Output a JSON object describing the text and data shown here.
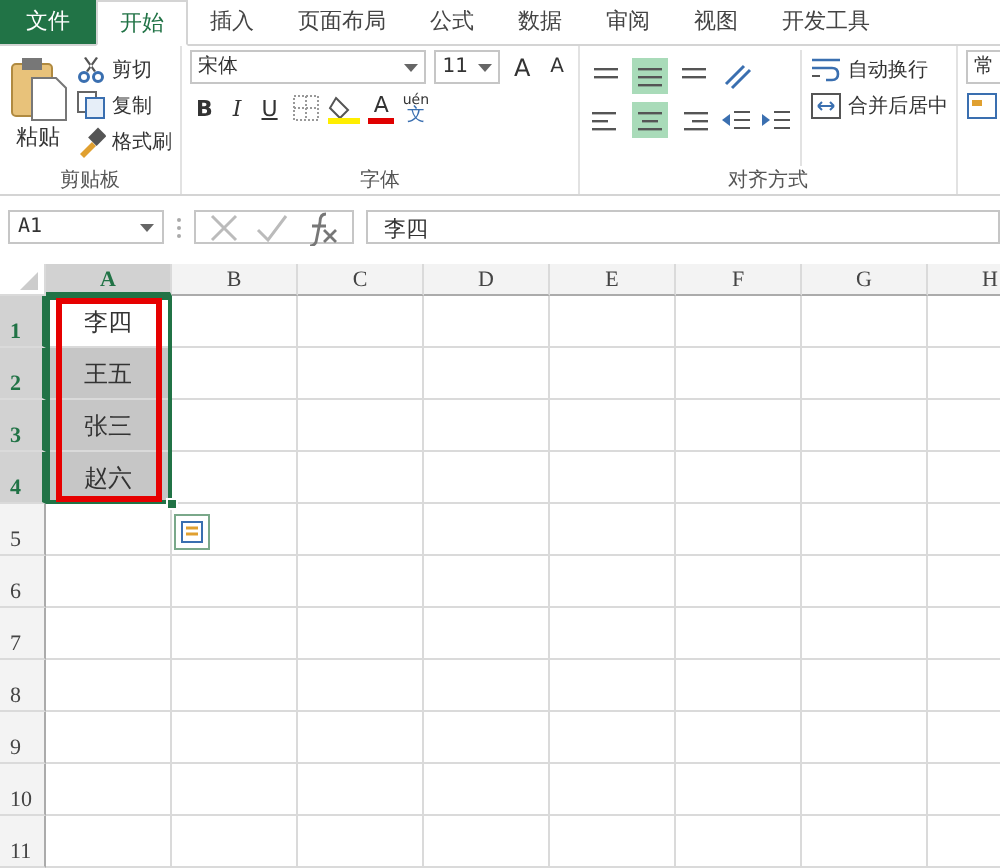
{
  "tabs": [
    {
      "label": "文件",
      "kind": "file",
      "selected": false
    },
    {
      "label": "开始",
      "kind": "tab",
      "selected": true
    },
    {
      "label": "插入",
      "kind": "tab",
      "selected": false
    },
    {
      "label": "页面布局",
      "kind": "tab",
      "selected": false
    },
    {
      "label": "公式",
      "kind": "tab",
      "selected": false
    },
    {
      "label": "数据",
      "kind": "tab",
      "selected": false
    },
    {
      "label": "审阅",
      "kind": "tab",
      "selected": false
    },
    {
      "label": "视图",
      "kind": "tab",
      "selected": false
    },
    {
      "label": "开发工具",
      "kind": "tab",
      "selected": false
    }
  ],
  "ribbon": {
    "clipboard": {
      "paste": "粘贴",
      "cut": "剪切",
      "copy": "复制",
      "format_painter": "格式刷",
      "group_label": "剪贴板"
    },
    "font": {
      "name": "宋体",
      "size": "11",
      "grow": "A",
      "shrink": "A",
      "bold": "B",
      "italic": "I",
      "underline": "U",
      "font_color": "A",
      "phonetic_top": "uén",
      "phonetic_bottom": "文",
      "group_label": "字体"
    },
    "alignment": {
      "wrap": "自动换行",
      "merge": "合并后居中",
      "group_label": "对齐方式"
    },
    "number": {
      "format": "常"
    }
  },
  "formula_bar": {
    "name_box": "A1",
    "value": "李四"
  },
  "sheet": {
    "columns": [
      {
        "label": "A",
        "selected": true
      },
      {
        "label": "B",
        "selected": false
      },
      {
        "label": "C",
        "selected": false
      },
      {
        "label": "D",
        "selected": false
      },
      {
        "label": "E",
        "selected": false
      },
      {
        "label": "F",
        "selected": false
      },
      {
        "label": "G",
        "selected": false
      },
      {
        "label": "H",
        "selected": false
      }
    ],
    "rows": [
      {
        "label": "1",
        "selected": true,
        "cells": [
          {
            "value": "李四",
            "selected": true,
            "active": true
          }
        ]
      },
      {
        "label": "2",
        "selected": true,
        "cells": [
          {
            "value": "王五",
            "selected": true,
            "active": false
          }
        ]
      },
      {
        "label": "3",
        "selected": true,
        "cells": [
          {
            "value": "张三",
            "selected": true,
            "active": false
          }
        ]
      },
      {
        "label": "4",
        "selected": true,
        "cells": [
          {
            "value": "赵六",
            "selected": true,
            "active": false
          }
        ]
      },
      {
        "label": "5",
        "selected": false,
        "cells": []
      },
      {
        "label": "6",
        "selected": false,
        "cells": []
      },
      {
        "label": "7",
        "selected": false,
        "cells": []
      },
      {
        "label": "8",
        "selected": false,
        "cells": []
      },
      {
        "label": "9",
        "selected": false,
        "cells": []
      },
      {
        "label": "10",
        "selected": false,
        "cells": []
      },
      {
        "label": "11",
        "selected": false,
        "cells": []
      }
    ]
  }
}
